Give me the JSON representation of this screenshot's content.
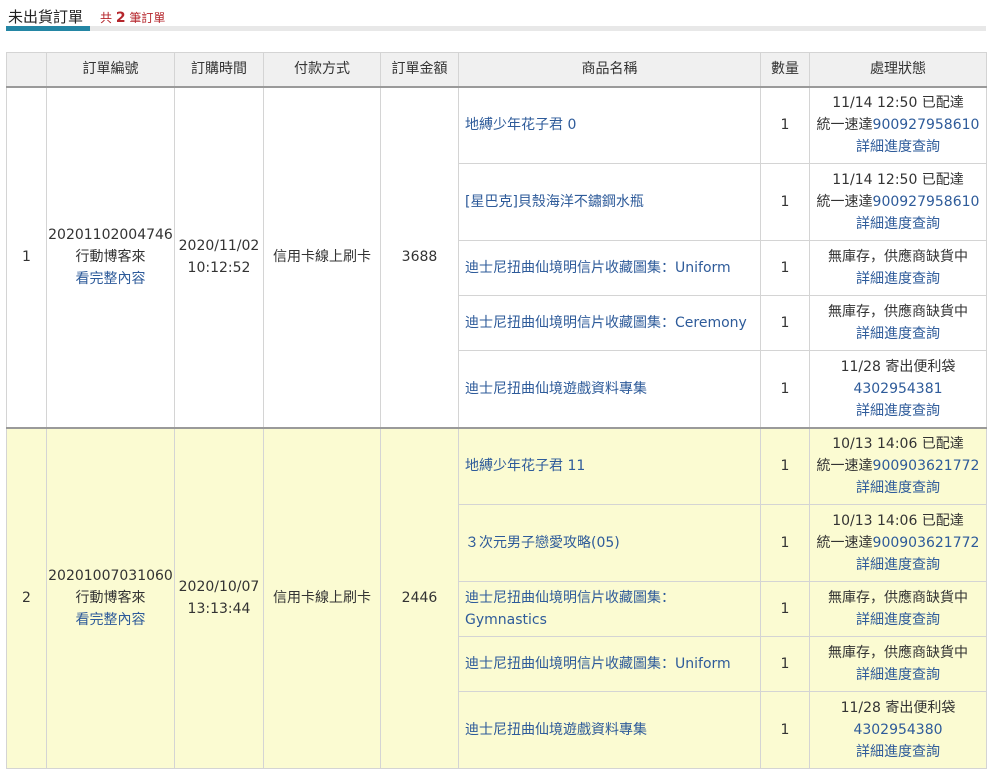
{
  "tab": {
    "title": "未出貨訂單",
    "count_prefix": "共",
    "count": "2",
    "count_suffix": "筆訂單"
  },
  "columns": [
    "",
    "訂單編號",
    "訂購時間",
    "付款方式",
    "訂單金額",
    "商品名稱",
    "數量",
    "處理狀態"
  ],
  "orders": [
    {
      "index": "1",
      "order_no": "20201102004746",
      "source": "行動博客來",
      "detail_link": "看完整內容",
      "date": "2020/11/02",
      "time": "10:12:52",
      "payment": "信用卡線上刷卡",
      "amount": "3688",
      "items": [
        {
          "name": "地縛少年花子君 0",
          "qty": "1",
          "status_lines": [
            "11/14 12:50 已配達"
          ],
          "status_link_lines": [
            "統一速達900927958610"
          ],
          "tracking_prefix": "統一速達",
          "tracking_no": "900927958610",
          "progress_link": "詳細進度查詢"
        },
        {
          "name": "[星巴克]貝殼海洋不鏽鋼水瓶",
          "qty": "1",
          "status_lines": [
            "11/14 12:50 已配達"
          ],
          "tracking_prefix": "統一速達",
          "tracking_no": "900927958610",
          "progress_link": "詳細進度查詢"
        },
        {
          "name": "迪士尼扭曲仙境明信片收藏圖集：Uniform",
          "qty": "1",
          "status_lines": [
            "無庫存，供應商缺貨中"
          ],
          "tracking_prefix": "",
          "tracking_no": "",
          "progress_link": "詳細進度查詢"
        },
        {
          "name": "迪士尼扭曲仙境明信片收藏圖集：Ceremony",
          "qty": "1",
          "status_lines": [
            "無庫存，供應商缺貨中"
          ],
          "tracking_prefix": "",
          "tracking_no": "",
          "progress_link": "詳細進度查詢"
        },
        {
          "name": "迪士尼扭曲仙境遊戲資料專集",
          "qty": "1",
          "status_lines": [
            "11/28 寄出便利袋"
          ],
          "tracking_prefix": "",
          "tracking_no": "4302954381",
          "progress_link": "詳細進度查詢"
        }
      ]
    },
    {
      "index": "2",
      "order_no": "20201007031060",
      "source": "行動博客來",
      "detail_link": "看完整內容",
      "date": "2020/10/07",
      "time": "13:13:44",
      "payment": "信用卡線上刷卡",
      "amount": "2446",
      "items": [
        {
          "name": "地縛少年花子君 11",
          "qty": "1",
          "status_lines": [
            "10/13 14:06 已配達"
          ],
          "tracking_prefix": "統一速達",
          "tracking_no": "900903621772",
          "progress_link": "詳細進度查詢"
        },
        {
          "name": "３次元男子戀愛攻略(05)",
          "qty": "1",
          "status_lines": [
            "10/13 14:06 已配達"
          ],
          "tracking_prefix": "統一速達",
          "tracking_no": "900903621772",
          "progress_link": "詳細進度查詢"
        },
        {
          "name": "迪士尼扭曲仙境明信片收藏圖集：Gymnastics",
          "qty": "1",
          "status_lines": [
            "無庫存，供應商缺貨中"
          ],
          "tracking_prefix": "",
          "tracking_no": "",
          "progress_link": "詳細進度查詢"
        },
        {
          "name": "迪士尼扭曲仙境明信片收藏圖集：Uniform",
          "qty": "1",
          "status_lines": [
            "無庫存，供應商缺貨中"
          ],
          "tracking_prefix": "",
          "tracking_no": "",
          "progress_link": "詳細進度查詢"
        },
        {
          "name": "迪士尼扭曲仙境遊戲資料專集",
          "qty": "1",
          "status_lines": [
            "11/28 寄出便利袋"
          ],
          "tracking_prefix": "",
          "tracking_no": "4302954380",
          "progress_link": "詳細進度查詢"
        }
      ]
    }
  ]
}
